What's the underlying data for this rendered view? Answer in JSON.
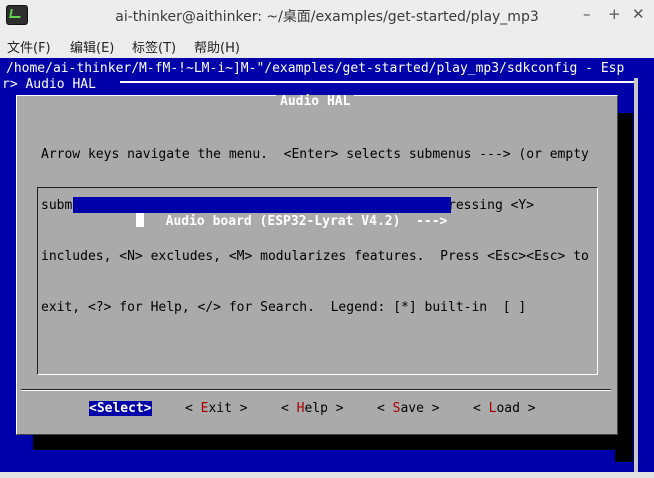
{
  "window": {
    "title": "ai-thinker@aithinker: ~/桌面/examples/get-started/play_mp3",
    "minimize": "–",
    "maximize": "+",
    "close": "✕"
  },
  "menubar": [
    {
      "label": "文件(F)"
    },
    {
      "label": "编辑(E)"
    },
    {
      "label": "标签(T)"
    },
    {
      "label": "帮助(H)"
    }
  ],
  "terminal": {
    "path_line": "/home/ai-thinker/M-fM-!~LM-i~]M-\"/examples/get-started/play_mp3/sdkconfig - Esp",
    "breadcrumb": "r> Audio HAL"
  },
  "dialog": {
    "title": "Audio HAL",
    "help_lines": [
      "Arrow keys navigate the menu.  <Enter> selects submenus ---> (or empty",
      "submenus ----).  Highlighted letters are hotkeys.  Pressing <Y>",
      "includes, <N> excludes, <M> modularizes features.  Press <Esc><Esc> to",
      "exit, <?> for Help, </> for Search.  Legend: [*] built-in  [ ]"
    ],
    "entries": [
      {
        "label": "Audio board (ESP32-Lyrat V4.2)  --->",
        "selected": true
      }
    ],
    "buttons": {
      "select": {
        "open": "<",
        "label": "Select",
        "close": ">"
      },
      "exit": {
        "open": "< ",
        "hot": "E",
        "rest": "xit",
        "close": " >"
      },
      "help": {
        "open": "< ",
        "hot": "H",
        "rest": "elp",
        "close": " >"
      },
      "save": {
        "open": "< ",
        "hot": "S",
        "rest": "ave",
        "close": " >"
      },
      "load": {
        "open": "< ",
        "hot": "L",
        "rest": "oad",
        "close": " >"
      }
    }
  },
  "colors": {
    "terminal_bg": "#0000aa",
    "dialog_bg": "#aaaaaa",
    "hotkey": "#aa0000",
    "highlight": "#0000aa"
  },
  "icons": {
    "app": "terminal-icon"
  }
}
